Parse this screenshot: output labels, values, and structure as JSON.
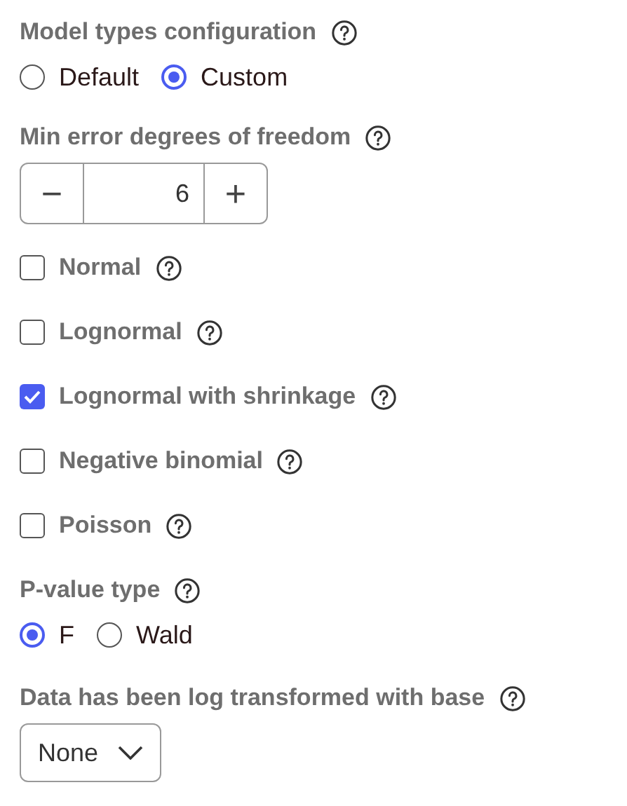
{
  "model_types": {
    "label": "Model types configuration",
    "options": [
      {
        "label": "Default",
        "selected": false
      },
      {
        "label": "Custom",
        "selected": true
      }
    ]
  },
  "min_error_df": {
    "label": "Min error degrees of freedom",
    "value": "6",
    "decrement": "−",
    "increment": "+"
  },
  "models": [
    {
      "label": "Normal",
      "checked": false
    },
    {
      "label": "Lognormal",
      "checked": false
    },
    {
      "label": "Lognormal with shrinkage",
      "checked": true
    },
    {
      "label": "Negative binomial",
      "checked": false
    },
    {
      "label": "Poisson",
      "checked": false
    }
  ],
  "p_value_type": {
    "label": "P-value type",
    "options": [
      {
        "label": "F",
        "selected": true
      },
      {
        "label": "Wald",
        "selected": false
      }
    ]
  },
  "log_base": {
    "label": "Data has been log transformed with base",
    "value": "None"
  }
}
